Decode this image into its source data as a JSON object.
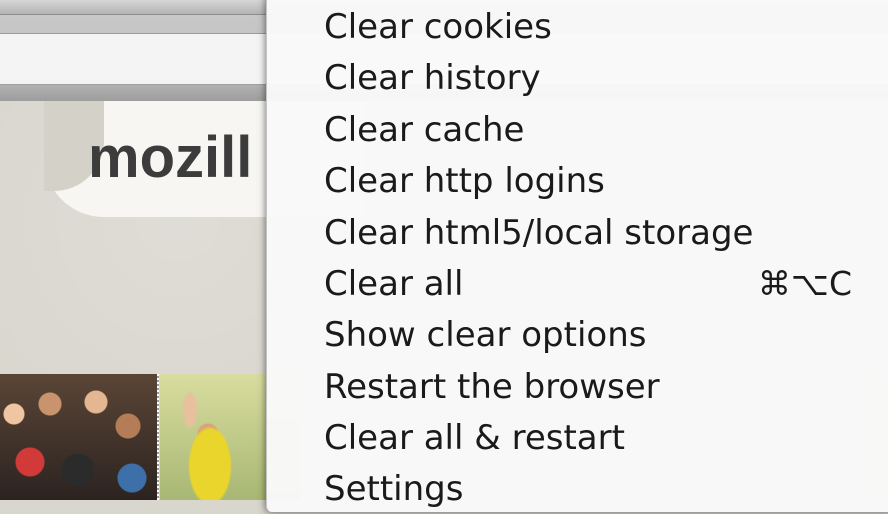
{
  "background_page": {
    "logo_text": "mozill"
  },
  "menu": {
    "items": [
      {
        "label": "Clear cookies",
        "shortcut": ""
      },
      {
        "label": "Clear history",
        "shortcut": ""
      },
      {
        "label": "Clear cache",
        "shortcut": ""
      },
      {
        "label": "Clear http logins",
        "shortcut": ""
      },
      {
        "label": "Clear html5/local storage",
        "shortcut": ""
      },
      {
        "label": "Clear all",
        "shortcut": "⌘⌥C"
      },
      {
        "label": "Show clear options",
        "shortcut": ""
      },
      {
        "label": "Restart the browser",
        "shortcut": ""
      },
      {
        "label": "Clear all & restart",
        "shortcut": ""
      },
      {
        "label": "Settings",
        "shortcut": ""
      }
    ]
  }
}
